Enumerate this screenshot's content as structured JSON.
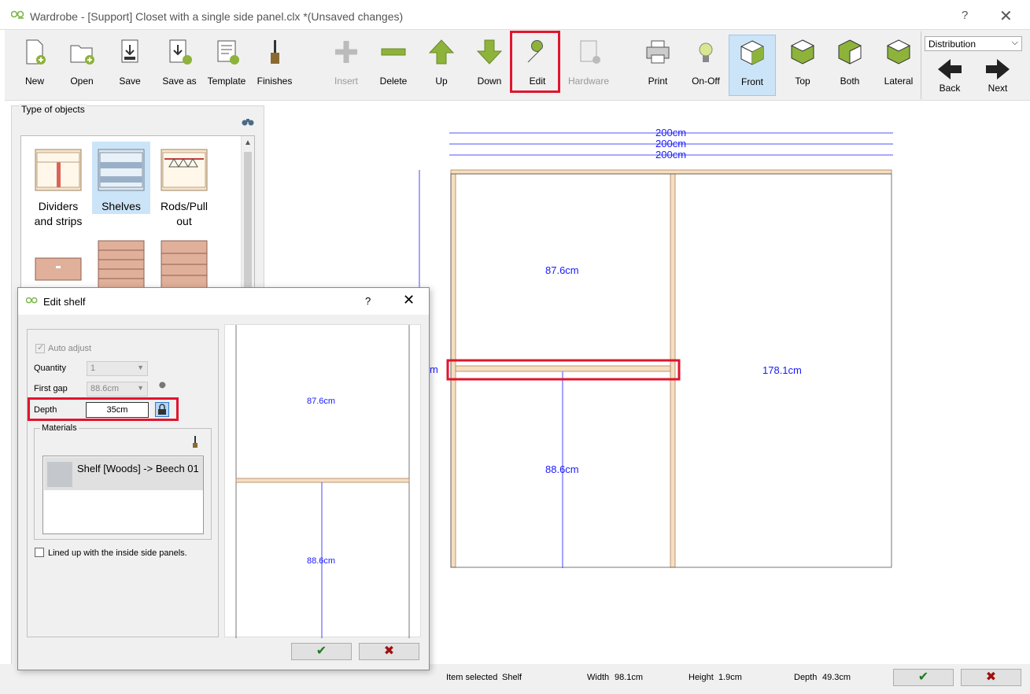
{
  "window": {
    "title": "Wardrobe - [Support] Closet with a single side panel.clx *(Unsaved changes)",
    "help_label": "?",
    "close_label": "✕"
  },
  "toolbar": {
    "buttons": [
      {
        "label": "New",
        "icon": "new-file-icon",
        "enabled": true
      },
      {
        "label": "Open",
        "icon": "open-folder-icon",
        "enabled": true
      },
      {
        "label": "Save",
        "icon": "save-icon",
        "enabled": true
      },
      {
        "label": "Save as",
        "icon": "save-as-icon",
        "enabled": true
      },
      {
        "label": "Template",
        "icon": "template-icon",
        "enabled": true
      },
      {
        "label": "Finishes",
        "icon": "paintbrush-icon",
        "enabled": true
      },
      {
        "label": "Insert",
        "icon": "plus-icon",
        "enabled": false
      },
      {
        "label": "Delete",
        "icon": "minus-icon",
        "enabled": true
      },
      {
        "label": "Up",
        "icon": "arrow-up-icon",
        "enabled": true
      },
      {
        "label": "Down",
        "icon": "arrow-down-icon",
        "enabled": true
      },
      {
        "label": "Edit",
        "icon": "wrench-icon",
        "enabled": true,
        "highlighted": true
      },
      {
        "label": "Hardware",
        "icon": "hardware-icon",
        "enabled": false
      },
      {
        "label": "Print",
        "icon": "printer-icon",
        "enabled": true
      },
      {
        "label": "On-Off",
        "icon": "lightbulb-icon",
        "enabled": true
      },
      {
        "label": "Front",
        "icon": "cube-front-icon",
        "enabled": true,
        "active": true
      },
      {
        "label": "Top",
        "icon": "cube-top-icon",
        "enabled": true
      },
      {
        "label": "Both",
        "icon": "cube-both-icon",
        "enabled": true
      },
      {
        "label": "Lateral",
        "icon": "cube-lateral-icon",
        "enabled": true
      },
      {
        "label": "Back",
        "icon": "arrow-left-icon",
        "enabled": true
      },
      {
        "label": "Next",
        "icon": "arrow-right-icon",
        "enabled": true
      }
    ],
    "view_select": "Distribution",
    "colors": {
      "green": "#8db33a",
      "highlight": "#e0152d",
      "active_bg": "#cce4f7"
    }
  },
  "left_panel": {
    "title": "Type of objects",
    "objects": [
      {
        "label": "Dividers and strips",
        "selected": false
      },
      {
        "label": "Shelves",
        "selected": true
      },
      {
        "label": "Rods/Pull out",
        "selected": false
      },
      {
        "label": "",
        "selected": false
      },
      {
        "label": "",
        "selected": false
      },
      {
        "label": "",
        "selected": false
      }
    ]
  },
  "drawing": {
    "width_dims": [
      "200cm",
      "200cm",
      "200cm"
    ],
    "left_upper": "87.6cm",
    "left_lower": "88.6cm",
    "right_height": "178.1cm",
    "side_label": "m",
    "line_color": "#1a1aff",
    "wood_color": "#f5dfc0"
  },
  "dialog": {
    "title": "Edit shelf",
    "help_label": "?",
    "close_label": "✕",
    "auto_adjust_label": "Auto adjust",
    "quantity_label": "Quantity",
    "quantity_value": "1",
    "first_gap_label": "First gap",
    "first_gap_value": "88.6cm",
    "depth_label": "Depth",
    "depth_value": "35cm",
    "materials_label": "Materials",
    "material_item": "Shelf [Woods] -> Beech 01",
    "lined_up_label": "Lined up with the inside side panels.",
    "preview_upper": "87.6cm",
    "preview_lower": "88.6cm"
  },
  "status": {
    "item_selected_label": "Item selected",
    "item_selected_value": "Shelf",
    "width_label": "Width",
    "width_value": "98.1cm",
    "height_label": "Height",
    "height_value": "1.9cm",
    "depth_label": "Depth",
    "depth_value": "49.3cm"
  }
}
